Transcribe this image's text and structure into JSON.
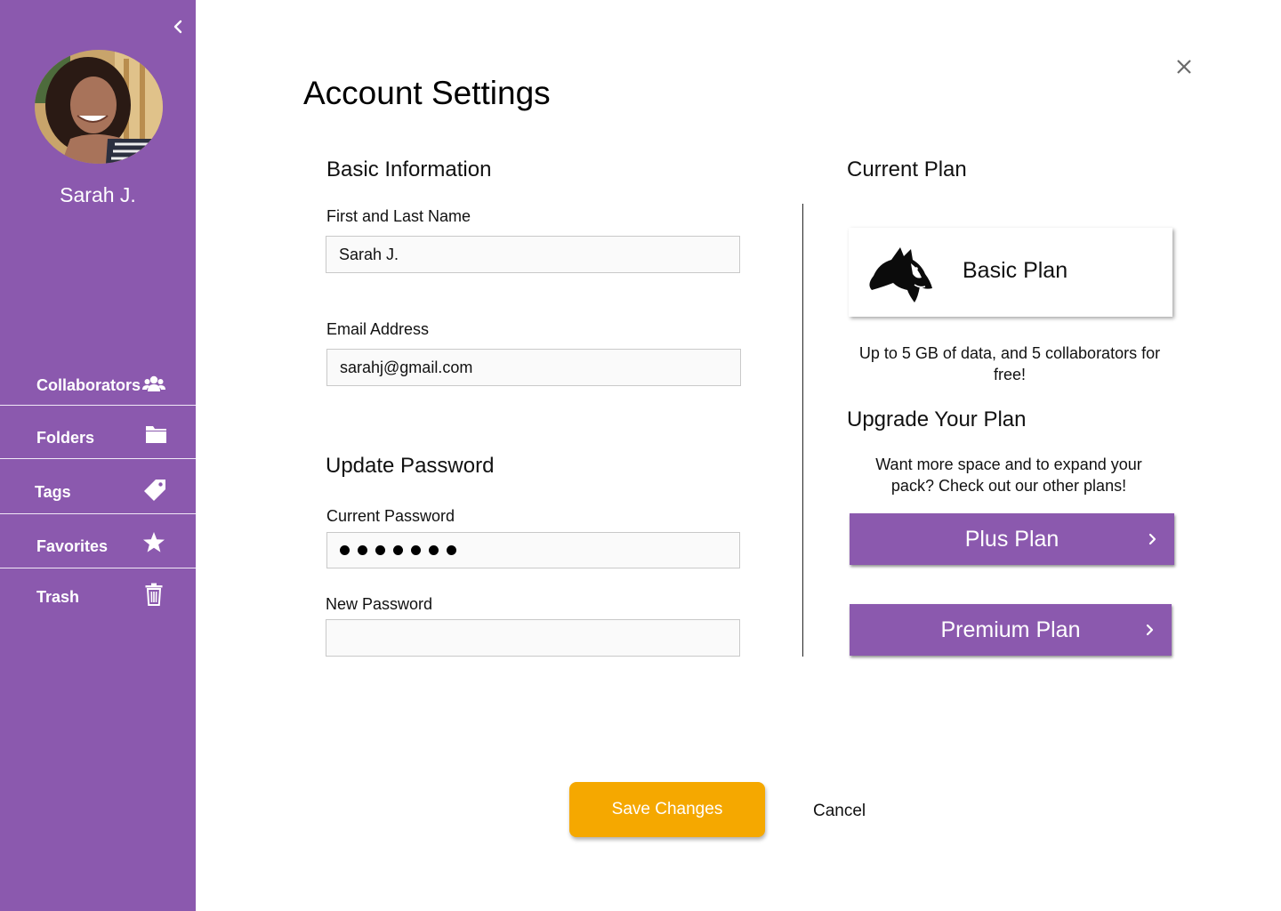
{
  "colors": {
    "sidebar": "#8b59ae",
    "accent": "#8b59ae",
    "save_button": "#f5a800"
  },
  "sidebar": {
    "collapse_icon": "chevron-left-icon",
    "username": "Sarah J.",
    "items": [
      {
        "label": "Collaborators",
        "icon": "users-icon"
      },
      {
        "label": "Folders",
        "icon": "folder-icon"
      },
      {
        "label": "Tags",
        "icon": "tag-icon"
      },
      {
        "label": "Favorites",
        "icon": "star-icon"
      },
      {
        "label": "Trash",
        "icon": "trash-icon"
      }
    ]
  },
  "main": {
    "title": "Account Settings",
    "close_icon": "close-icon",
    "basic_info": {
      "title": "Basic Information",
      "name_label": "First and Last Name",
      "name_value": "Sarah J.",
      "email_label": "Email Address",
      "email_value": "sarahj@gmail.com"
    },
    "password": {
      "title": "Update Password",
      "current_label": "Current Password",
      "current_masked_length": 7,
      "new_label": "New Password",
      "new_value": ""
    },
    "plan": {
      "current_title": "Current Plan",
      "current_name": "Basic Plan",
      "current_logo": "wolf-logo",
      "current_desc": "Up to 5 GB of data, and 5 collaborators for free!",
      "upgrade_title": "Upgrade Your Plan",
      "upgrade_desc": "Want more space and to expand your pack? Check out our other plans!",
      "options": [
        {
          "label": "Plus Plan",
          "icon": "chevron-right-icon"
        },
        {
          "label": "Premium Plan",
          "icon": "chevron-right-icon"
        }
      ]
    },
    "actions": {
      "save": "Save Changes",
      "cancel": "Cancel"
    }
  }
}
